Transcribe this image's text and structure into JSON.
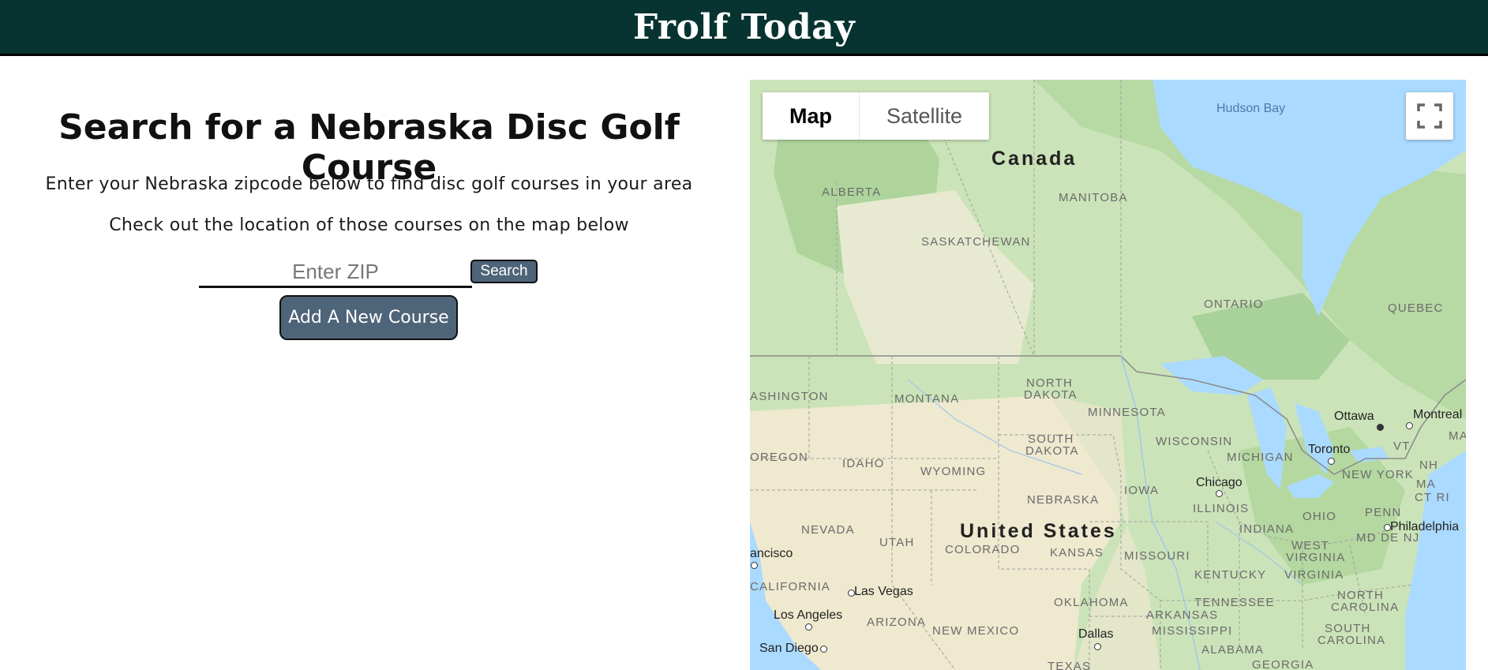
{
  "header": {
    "title": "Frolf Today"
  },
  "search_panel": {
    "title": "Search for a Nebraska Disc Golf Course",
    "description1": "Enter your Nebraska zipcode below to find disc golf courses in your area",
    "description2": "Check out the location of those courses on the map below",
    "zip_placeholder": "Enter ZIP",
    "search_label": "Search",
    "add_course_label": "Add A New Course"
  },
  "map": {
    "type_tabs": [
      "Map",
      "Satellite"
    ],
    "active_tab": "Map",
    "labels": {
      "canada": "Canada",
      "united_states": "United States",
      "hudson_bay": "Hudson Bay",
      "alberta": "ALBERTA",
      "manitoba": "MANITOBA",
      "saskatchewan": "SASKATCHEWAN",
      "ontario": "ONTARIO",
      "quebec": "QUEBEC",
      "washington": "ASHINGTON",
      "montana": "MONTANA",
      "north_dakota_1": "NORTH",
      "north_dakota_2": "DAKOTA",
      "minnesota": "MINNESOTA",
      "south_dakota_1": "SOUTH",
      "south_dakota_2": "DAKOTA",
      "wisconsin": "WISCONSIN",
      "michigan": "MICHIGAN",
      "oregon": "OREGON",
      "idaho": "IDAHO",
      "wyoming": "WYOMING",
      "nebraska": "NEBRASKA",
      "iowa": "IOWA",
      "illinois": "ILLINOIS",
      "indiana": "INDIANA",
      "ohio": "OHIO",
      "penn": "PENN",
      "new_york": "NEW YORK",
      "vt": "VT",
      "nh": "NH",
      "ma": "MA",
      "ct_ri": "CT RI",
      "md_de_nj": "MD DE NJ",
      "nevada": "NEVADA",
      "utah": "UTAH",
      "colorado": "COLORADO",
      "kansas": "KANSAS",
      "missouri": "MISSOURI",
      "west_virginia_1": "WEST",
      "west_virginia_2": "VIRGINIA",
      "kentucky": "KENTUCKY",
      "virginia": "VIRGINIA",
      "california": "CALIFORNIA",
      "arizona": "ARIZONA",
      "new_mexico": "NEW MEXICO",
      "oklahoma": "OKLAHOMA",
      "arkansas": "ARKANSAS",
      "tennessee": "TENNESSEE",
      "north_carolina_1": "NORTH",
      "north_carolina_2": "CAROLINA",
      "mississippi": "MISSISSIPPI",
      "south_carolina_1": "SOUTH",
      "south_carolina_2": "CAROLINA",
      "alabama": "ALABAMA",
      "georgia": "GEORGIA",
      "texas": "TEXAS",
      "ottawa": "Ottawa",
      "montreal": "Montreal",
      "toronto": "Toronto",
      "chicago": "Chicago",
      "philadelphia": "Philadelphia",
      "san_francisco": "ancisco",
      "las_vegas": "Las Vegas",
      "los_angeles": "Los Angeles",
      "san_diego": "San Diego",
      "dallas": "Dallas",
      "maine_partial": "MA"
    },
    "colors": {
      "land": "#cbe3b8",
      "water": "#aadaff",
      "dry": "#eee9cf",
      "forest": "#a9d19a"
    }
  }
}
